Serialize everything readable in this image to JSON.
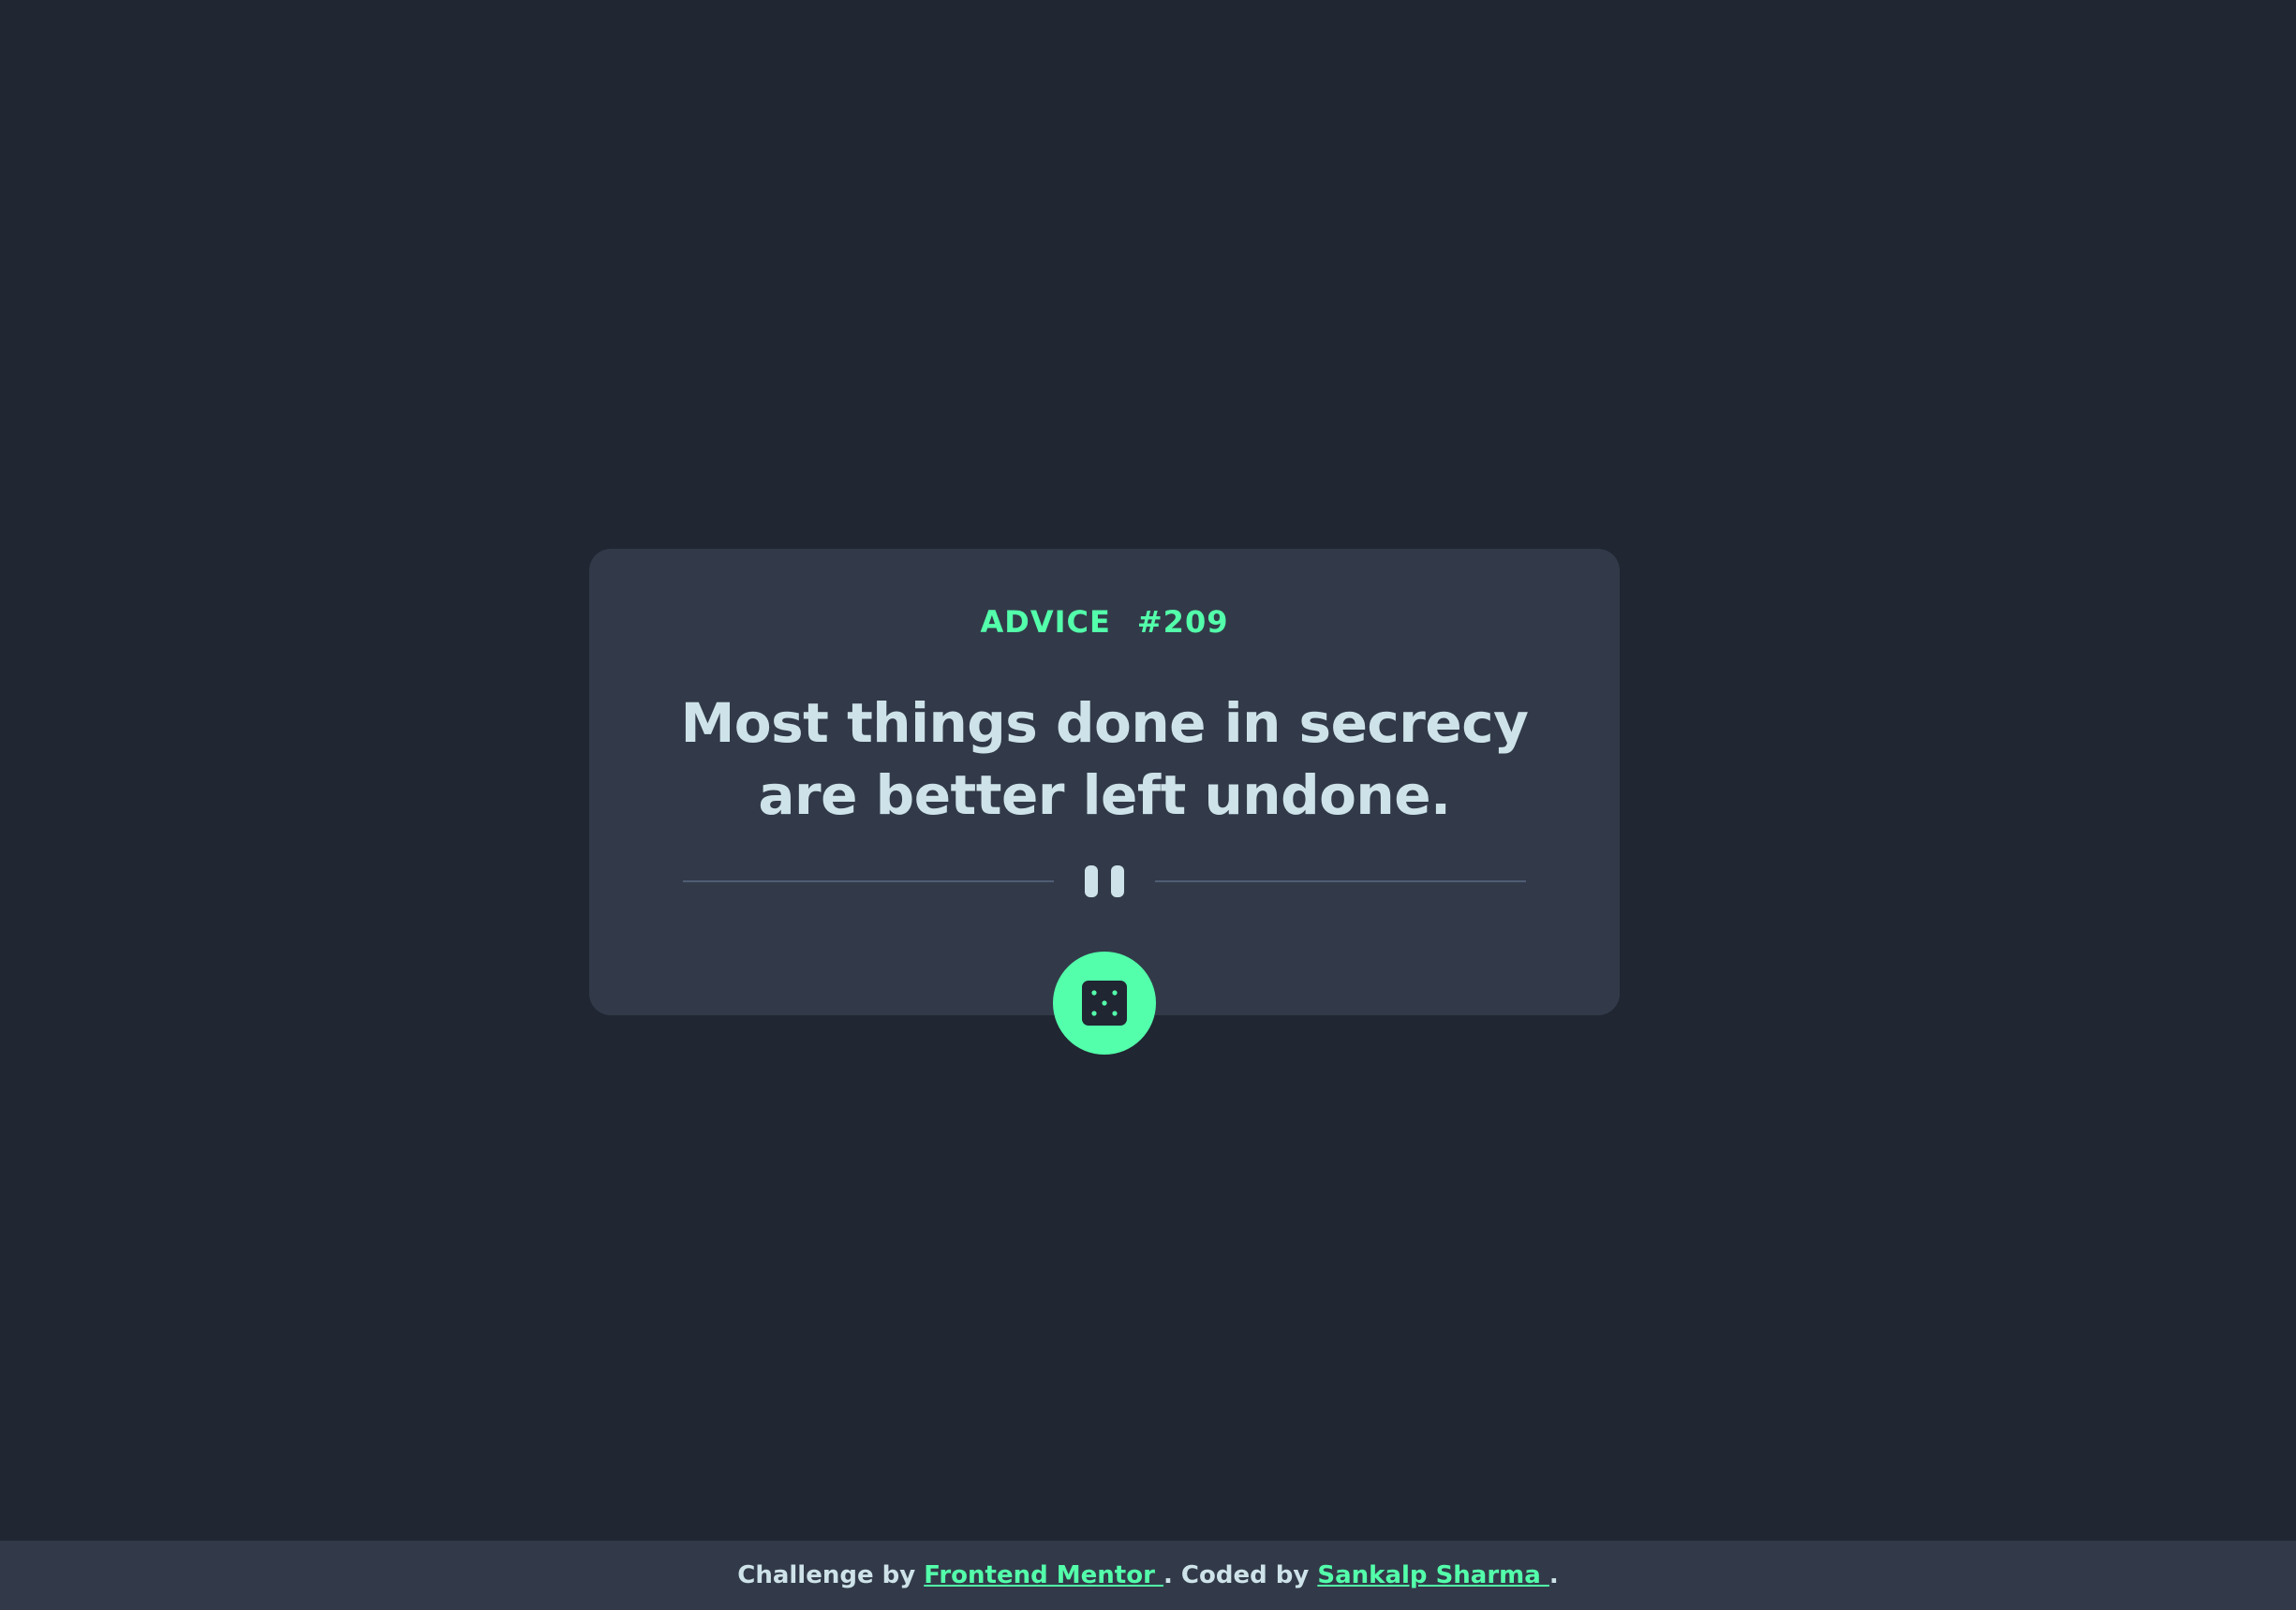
{
  "advice": {
    "label": "ADVICE",
    "number": "#209",
    "text": "Most things done in secrecy are better left undone."
  },
  "button": {
    "icon": "dice-icon",
    "accent_color": "#53ffaa"
  },
  "divider": {
    "icon": "pause-icon"
  },
  "footer": {
    "challenge_prefix": "Challenge by ",
    "challenge_link": "Frontend Mentor ",
    "coded_prefix": ". Coded by ",
    "coder_link": "Sankalp Sharma ",
    "suffix": "."
  },
  "colors": {
    "background": "#202632",
    "card": "#323a49",
    "text": "#cee3e9",
    "accent": "#53ffaa",
    "divider": "#4f5d74"
  }
}
